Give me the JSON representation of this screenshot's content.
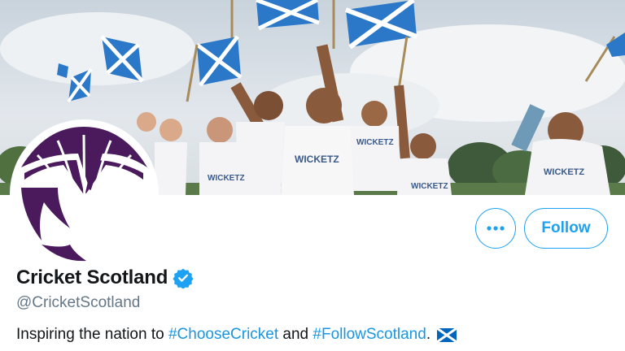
{
  "profile": {
    "display_name": "Cricket Scotland",
    "handle": "@CricketScotland",
    "verified": true
  },
  "actions": {
    "more_icon": "more-horizontal-icon",
    "follow_label": "Follow"
  },
  "bio": {
    "text_1": "Inspiring the nation to ",
    "hashtag_1": "#ChooseCricket",
    "text_2": " and ",
    "hashtag_2": "#FollowScotland",
    "text_3": ".",
    "emoji": "scotland-flag-icon"
  },
  "header_image": {
    "shirt_texts": [
      "WICKETZ",
      "WICKETZ",
      "WICKETZ",
      "WICKETZ",
      "WICKETZ"
    ]
  },
  "colors": {
    "accent": "#1da1f2",
    "link": "#1b95e0",
    "logo_purple": "#4a1a5c",
    "flag_blue": "#0065bd"
  }
}
